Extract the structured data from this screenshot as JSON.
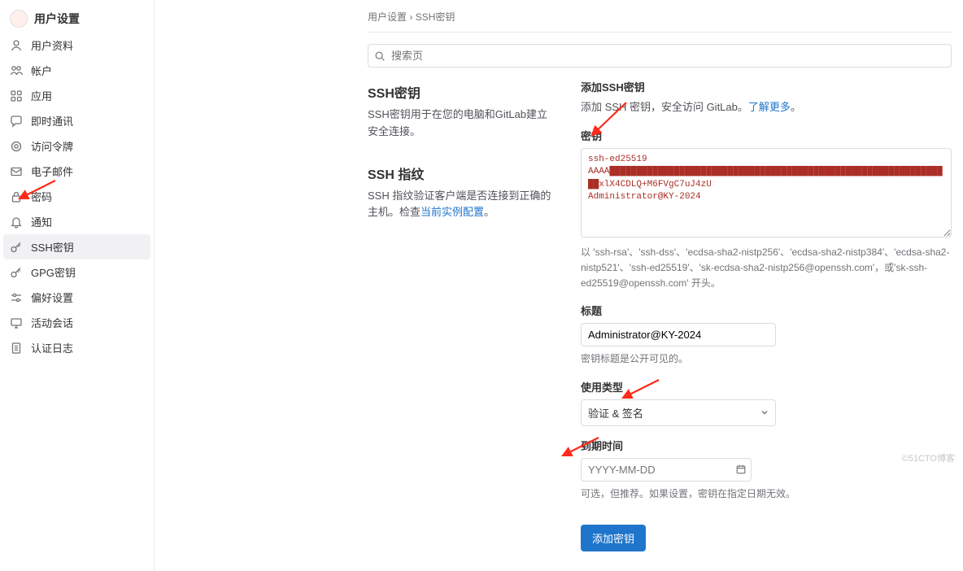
{
  "sidebar": {
    "title": "用户设置",
    "items": [
      {
        "icon": "user",
        "label": "用户资料"
      },
      {
        "icon": "account",
        "label": "帐户"
      },
      {
        "icon": "apps",
        "label": "应用"
      },
      {
        "icon": "chat",
        "label": "即时通讯"
      },
      {
        "icon": "token",
        "label": "访问令牌"
      },
      {
        "icon": "mail",
        "label": "电子邮件"
      },
      {
        "icon": "lock",
        "label": "密码"
      },
      {
        "icon": "bell",
        "label": "通知"
      },
      {
        "icon": "key",
        "label": "SSH密钥"
      },
      {
        "icon": "key",
        "label": "GPG密钥"
      },
      {
        "icon": "pref",
        "label": "偏好设置"
      },
      {
        "icon": "monitor",
        "label": "活动会话"
      },
      {
        "icon": "log",
        "label": "认证日志"
      }
    ]
  },
  "breadcrumbs": {
    "a": "用户设置",
    "sep": " › ",
    "b": "SSH密钥"
  },
  "search": {
    "placeholder": "搜索页"
  },
  "left": {
    "h1": "SSH密钥",
    "d1": "SSH密钥用于在您的电脑和GitLab建立安全连接。",
    "h2": "SSH 指纹",
    "d2a": "SSH 指纹验证客户端是否连接到正确的主机。检查",
    "d2_link": "当前实例配置",
    "d2b": "。"
  },
  "right": {
    "h": "添加SSH密钥",
    "d1a": "添加 SSH 密钥，安全访问 GitLab。",
    "d1_link": "了解更多",
    "d1b": "。",
    "key_label": "密钥",
    "key_value": "ssh-ed25519\nAAAA████████████████████████████████████████████████████████████████xlX4CDLQ+M6FVgC7uJ4zU\nAdministrator@KY-2024",
    "key_hint": "以 'ssh-rsa'、'ssh-dss'、'ecdsa-sha2-nistp256'、'ecdsa-sha2-nistp384'、'ecdsa-sha2-nistp521'、'ssh-ed25519'、'sk-ecdsa-sha2-nistp256@openssh.com'，或'sk-ssh-ed25519@openssh.com' 开头。",
    "title_label": "标题",
    "title_value": "Administrator@KY-2024",
    "title_hint": "密钥标题是公开可见的。",
    "usage_label": "使用类型",
    "usage_value": "验证 & 签名",
    "expiry_label": "到期时间",
    "expiry_placeholder": "YYYY-MM-DD",
    "expiry_hint": "可选，但推荐。如果设置，密钥在指定日期无效。",
    "submit": "添加密钥"
  },
  "watermark": "©51CTO博客"
}
